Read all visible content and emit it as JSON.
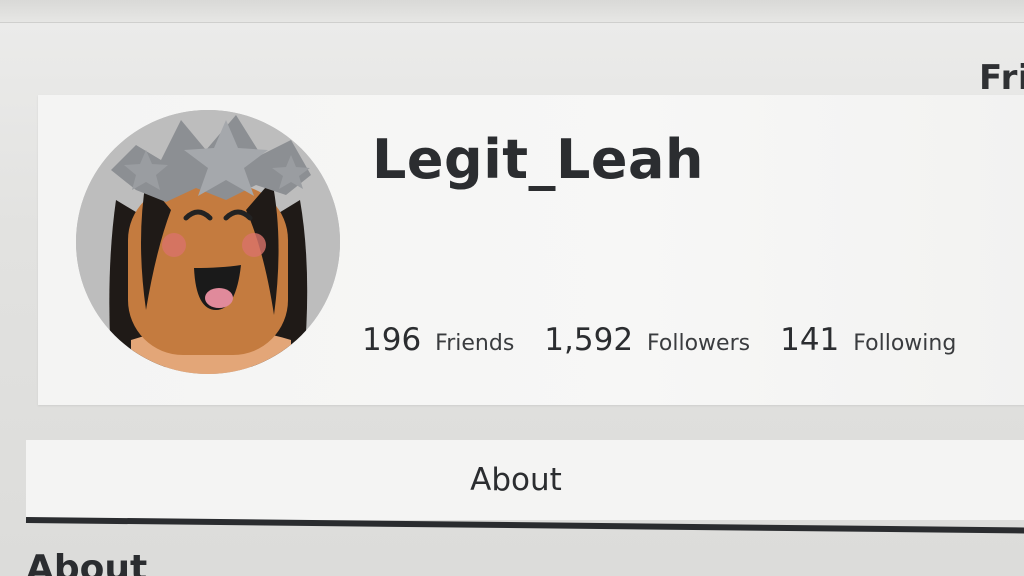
{
  "header": {
    "right_nav_partial": "Fri"
  },
  "profile": {
    "username": "Legit_Leah",
    "avatar_icon": "avatar-headshot",
    "stats": [
      {
        "count": "196",
        "label": "Friends"
      },
      {
        "count": "1,592",
        "label": "Followers"
      },
      {
        "count": "141",
        "label": "Following"
      }
    ]
  },
  "tabs": {
    "about_label": "About"
  },
  "section": {
    "about_heading": "About"
  },
  "colors": {
    "text": "#2b2d30",
    "card": "#f4f4f3",
    "page": "#e3e3e1",
    "underline": "#2a2c2f"
  }
}
